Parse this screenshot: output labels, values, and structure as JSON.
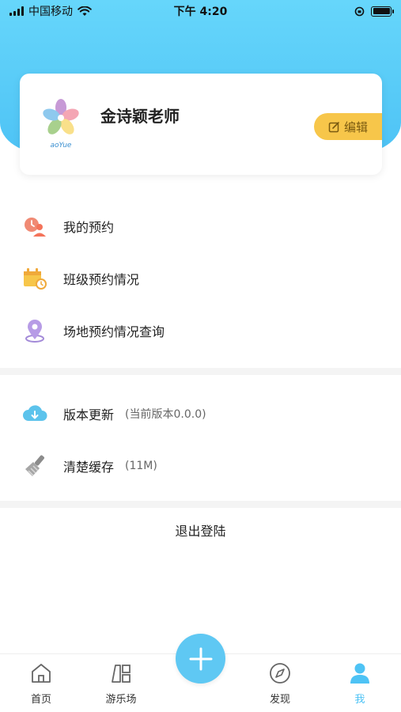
{
  "status_bar": {
    "carrier": "中国移动",
    "time": "下午 4:20"
  },
  "profile": {
    "name": "金诗颖老师",
    "logo_text": "aoYue",
    "edit_label": "编辑"
  },
  "menu_primary": [
    {
      "label": "我的预约",
      "icon": "my-appointment-icon"
    },
    {
      "label": "班级预约情况",
      "icon": "class-appointment-icon"
    },
    {
      "label": "场地预约情况查询",
      "icon": "venue-location-icon"
    }
  ],
  "menu_secondary": [
    {
      "label": "版本更新",
      "sub": "(当前版本0.0.0)",
      "icon": "cloud-download-icon"
    },
    {
      "label": "清楚缓存",
      "sub": "(11M)",
      "icon": "broom-icon"
    }
  ],
  "logout_label": "退出登陆",
  "tabbar": {
    "tabs": [
      {
        "label": "首页",
        "icon": "home-icon"
      },
      {
        "label": "游乐场",
        "icon": "playground-icon"
      },
      {
        "label": "发现",
        "icon": "compass-icon"
      },
      {
        "label": "我",
        "icon": "person-icon"
      }
    ],
    "active_index": 3,
    "add_icon": "plus-icon"
  },
  "colors": {
    "accent": "#4ec3f5",
    "edit_button": "#f7c64a"
  }
}
